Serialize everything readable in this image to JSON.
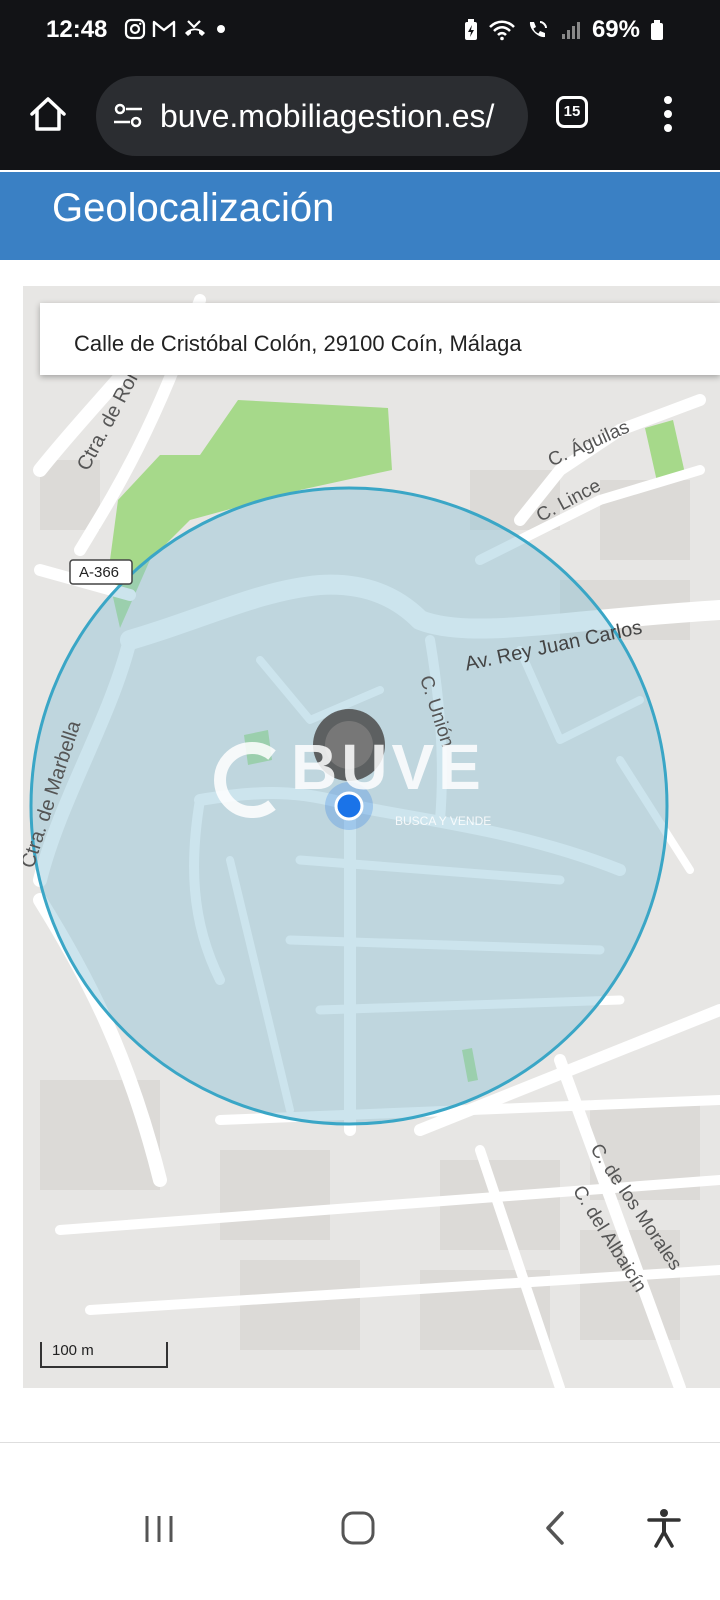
{
  "status_bar": {
    "time": "12:48",
    "battery": "69%",
    "left_icons": [
      "instagram-icon",
      "gmail-icon",
      "missed-call-icon",
      "dot-icon"
    ],
    "right_icons": [
      "battery-saver-icon",
      "wifi-icon",
      "wifi-calling-icon",
      "signal-icon",
      "battery-icon"
    ]
  },
  "browser": {
    "url": "buve.mobiliagestion.es/",
    "tab_count": "15"
  },
  "page": {
    "title": "Geolocalización"
  },
  "map": {
    "address": "Calle de Cristóbal Colón, 29100 Coín, Málaga",
    "scale": "100 m",
    "road_badge": "A-366",
    "street_labels": {
      "ronda": "Ctra. de Ronda",
      "marbella": "Ctra. de Marbella",
      "aguilas": "C. Águilas",
      "lince": "C. Lince",
      "rey": "Av. Rey Juan Carlos",
      "union": "C. Unión",
      "morales": "C. de los Morales",
      "albaicin": "C. del Albaicín"
    },
    "watermark": {
      "brand": "BUVE",
      "tagline": "BUSCA Y VENDE"
    },
    "colors": {
      "accuracy_fill": "#8fc3d6",
      "accuracy_stroke": "#3aa6c6",
      "location_dot": "#1a73e8",
      "park": "#a6d98a",
      "header": "#3a80c4"
    }
  }
}
